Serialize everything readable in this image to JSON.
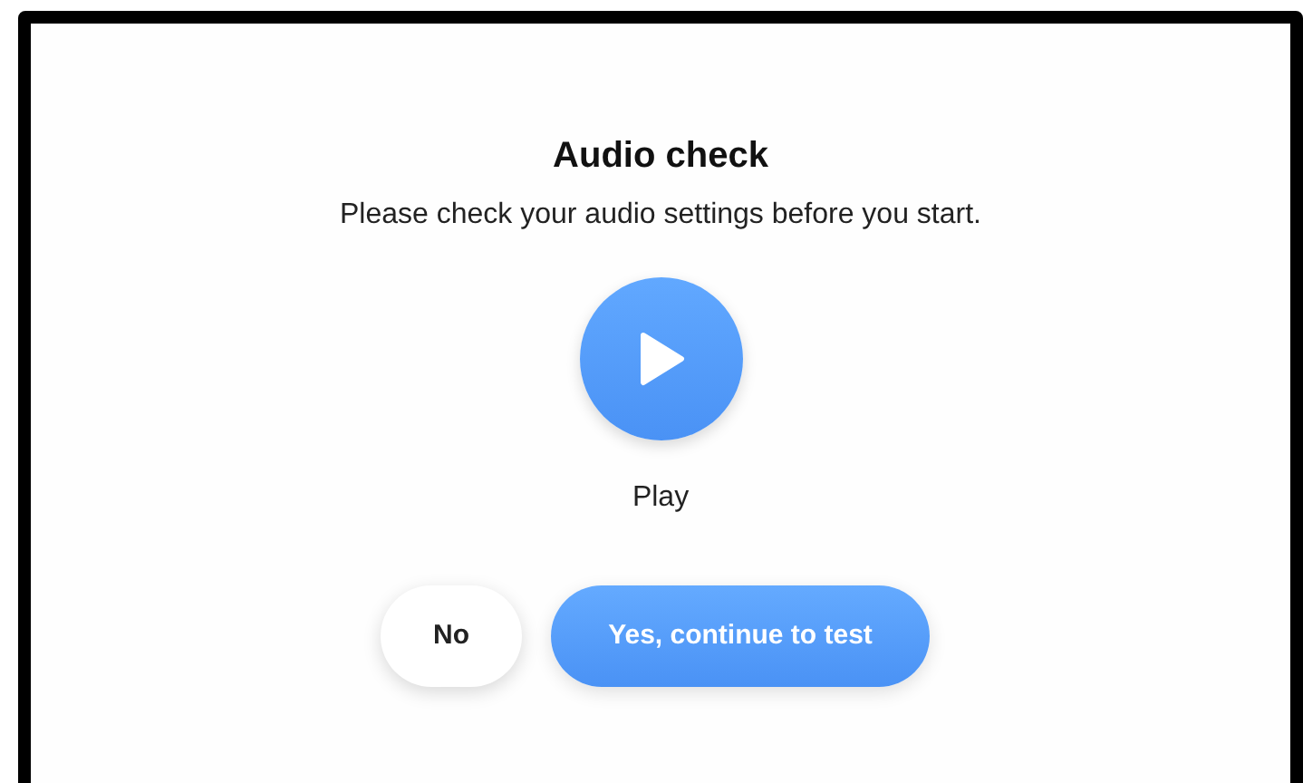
{
  "title": "Audio check",
  "subtitle": "Please check your audio settings before you start.",
  "play": {
    "label": "Play"
  },
  "buttons": [
    {
      "label": "No",
      "kind": "secondary"
    },
    {
      "label": "Yes, continue to test",
      "kind": "primary"
    }
  ]
}
